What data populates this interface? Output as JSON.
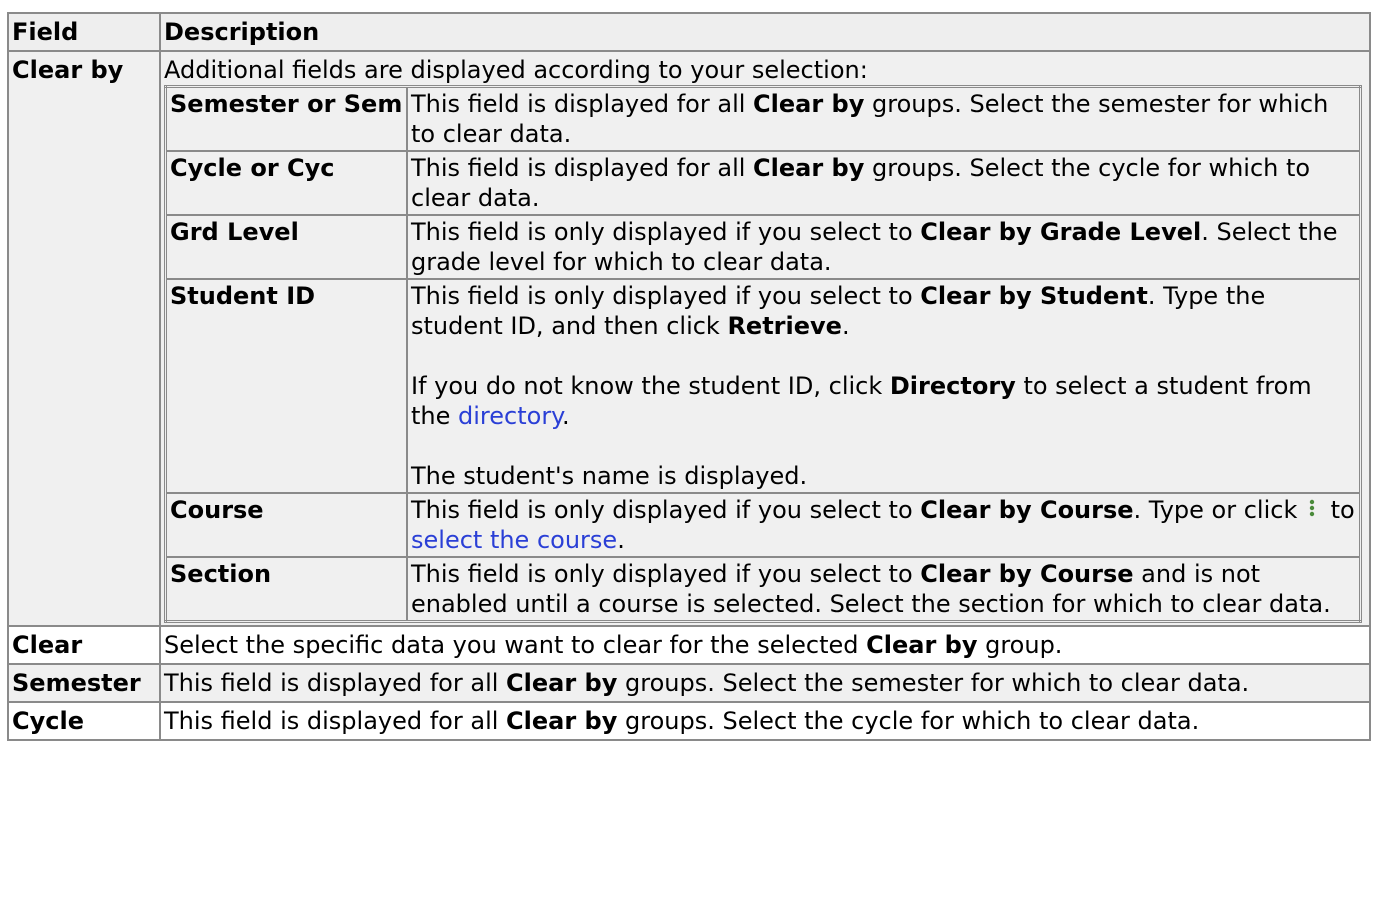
{
  "header": {
    "field": "Field",
    "description": "Description"
  },
  "clear_by": {
    "name": "Clear by",
    "intro": "Additional fields are displayed according to your selection:",
    "sub": {
      "semester": {
        "name": "Semester or Sem",
        "t1": "This field is displayed for all ",
        "b1": "Clear by",
        "t2": " groups. Select the semester for which to clear data."
      },
      "cycle": {
        "name": "Cycle or Cyc",
        "t1": "This field is displayed for all ",
        "b1": "Clear by",
        "t2": " groups. Select the cycle for which to clear data."
      },
      "grd_level": {
        "name": "Grd Level",
        "t1": "This field is only displayed if you select to ",
        "b1": "Clear by Grade Level",
        "t2": ". Select the grade level for which to clear data."
      },
      "student_id": {
        "name": "Student ID",
        "p1_t1": "This field is only displayed if you select to ",
        "p1_b1": "Clear by Student",
        "p1_t2": ". Type the student ID, and then click ",
        "p1_b2": "Retrieve",
        "p1_t3": ".",
        "p2_t1": "If you do not know the student ID, click ",
        "p2_b1": "Directory",
        "p2_t2": " to select a student from the ",
        "p2_link": "directory",
        "p2_t3": ".",
        "p3": "The student's name is displayed."
      },
      "course": {
        "name": "Course",
        "t1": "This field is only displayed if you select to ",
        "b1": "Clear by Course",
        "t2": ". Type or click ",
        "t3": " to ",
        "link": "select the course",
        "t4": ".",
        "icon": "kebab-menu-icon",
        "icon_color": "#4a8a3a"
      },
      "section": {
        "name": "Section",
        "t1": "This field is only displayed if you select to ",
        "b1": "Clear by Course",
        "t2": " and is not enabled until a course is selected. Select the section for which to clear data."
      }
    }
  },
  "clear": {
    "name": "Clear",
    "t1": "Select the specific data you want to clear for the selected ",
    "b1": "Clear by",
    "t2": " group."
  },
  "semester": {
    "name": "Semester",
    "t1": "This field is displayed for all ",
    "b1": "Clear by",
    "t2": " groups. Select the semester for which to clear data."
  },
  "cycle": {
    "name": "Cycle",
    "t1": "This field is displayed for all ",
    "b1": "Clear by",
    "t2": " groups. Select the cycle for which to clear data."
  },
  "colors": {
    "border": "#8a8a8a",
    "shade": "#f0f0f0",
    "header": "#eeeeee",
    "link": "#2a3fd6"
  }
}
